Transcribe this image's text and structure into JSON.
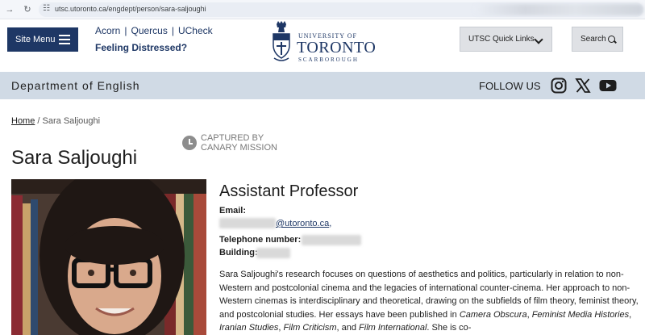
{
  "browser": {
    "url": "utsc.utoronto.ca/engdept/person/sara-saljoughi"
  },
  "header": {
    "site_menu_label": "Site Menu",
    "links": [
      "Acorn",
      "Quercus",
      "UCheck"
    ],
    "link_separator": "|",
    "distressed_label": "Feeling Distressed?",
    "logo": {
      "line1": "UNIVERSITY OF",
      "line2": "TORONTO",
      "line3": "SCARBOROUGH"
    },
    "quick_links_label": "UTSC Quick Links",
    "search_label": "Search"
  },
  "dept_bar": {
    "title": "Department of English",
    "follow_label": "FOLLOW US",
    "social_icons": [
      "instagram-icon",
      "x-icon",
      "youtube-icon"
    ]
  },
  "breadcrumb": {
    "home": "Home",
    "separator": "/",
    "current": "Sara Saljoughi"
  },
  "watermark": {
    "line1": "CAPTURED BY",
    "line2": "CANARY MISSION"
  },
  "profile": {
    "name": "Sara Saljoughi",
    "title": "Assistant Professor",
    "email_label": "Email:",
    "email_domain": "@utoronto.ca",
    "email_suffix": ",",
    "phone_label": "Telephone number:",
    "building_label": "Building:",
    "bio": {
      "p1": "Sara Saljoughi's research focuses on questions of aesthetics and politics, particularly in relation to non-Western and postcolonial cinema and the legacies of international counter-cinema. Her approach to non-Western cinemas is interdisciplinary and theoretical, drawing on the subfields of film theory, feminist theory, and postcolonial studies. Her essays have been published in ",
      "j1": "Camera Obscura",
      "s1": ", ",
      "j2": "Feminist Media Histories",
      "s2": ", ",
      "j3": "Iranian Studies",
      "s3": ", ",
      "j4": "Film Criticism",
      "s4": ", and ",
      "j5": "Film International",
      "p2": ". She is co-"
    }
  },
  "colors": {
    "navy": "#1e3765",
    "dept_bar": "#d0dae5",
    "button_grey": "#dfe1e5"
  }
}
